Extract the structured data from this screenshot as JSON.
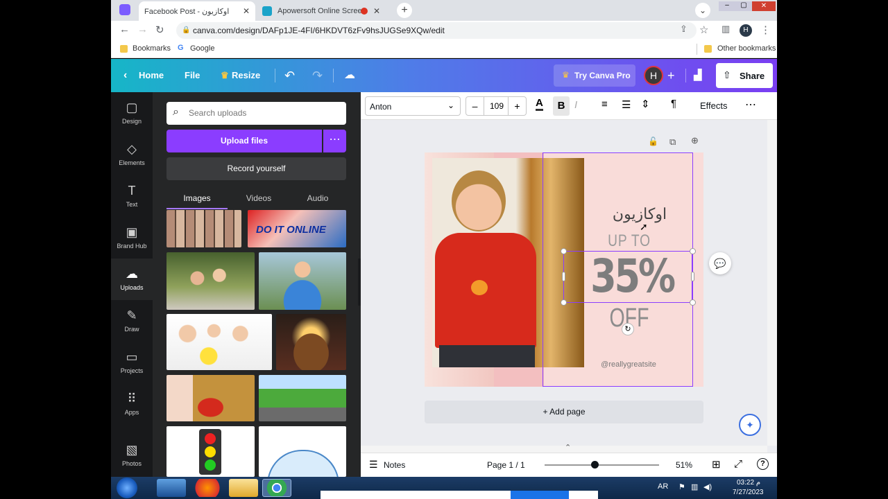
{
  "browser": {
    "tabs": [
      {
        "title": "Facebook Post - اوكازيون",
        "active": true
      },
      {
        "title": "Apowersoft Online Screen Re",
        "active": false
      }
    ],
    "url": "canva.com/design/DAFp1JE-4FI/6HKDVT6zFv9hsJUGSe9XQw/edit",
    "profile_initial": "H",
    "bookmarks": [
      "Bookmarks",
      "Google"
    ],
    "other_bookmarks": "Other bookmarks"
  },
  "canva_header": {
    "home": "Home",
    "file": "File",
    "resize": "Resize",
    "try_pro": "Try Canva Pro",
    "avatar_initial": "H",
    "share": "Share"
  },
  "rail": [
    {
      "label": "Design",
      "icon": "design-icon",
      "glyph": "▢"
    },
    {
      "label": "Elements",
      "icon": "elements-icon",
      "glyph": "◇"
    },
    {
      "label": "Text",
      "icon": "text-icon",
      "glyph": "T"
    },
    {
      "label": "Brand Hub",
      "icon": "brand-hub-icon",
      "glyph": "▣"
    },
    {
      "label": "Uploads",
      "icon": "cloud-upload-icon",
      "glyph": "☁"
    },
    {
      "label": "Draw",
      "icon": "draw-icon",
      "glyph": "✎"
    },
    {
      "label": "Projects",
      "icon": "folder-icon",
      "glyph": "▭"
    },
    {
      "label": "Apps",
      "icon": "apps-icon",
      "glyph": "⠿"
    },
    {
      "label": "Photos",
      "icon": "photos-icon",
      "glyph": "▧"
    }
  ],
  "uploads_panel": {
    "search_placeholder": "Search uploads",
    "upload_btn": "Upload files",
    "record_btn": "Record yourself",
    "tabs": [
      "Images",
      "Videos",
      "Audio"
    ],
    "thumb_text": "DO IT ONLINE"
  },
  "toolbar": {
    "font": "Anton",
    "font_size": "109",
    "effects": "Effects"
  },
  "canvas": {
    "arabic_title": "اوكازيون",
    "up_to": "UP TO",
    "percent": "35%",
    "off": "OFF",
    "handle": "@reallygreatsite",
    "add_page": "+ Add page"
  },
  "bottom": {
    "notes": "Notes",
    "page": "Page 1 / 1",
    "zoom": "51%",
    "zoom_fraction": 0.51
  },
  "taskbar": {
    "lang": "AR",
    "time": "03:22 م",
    "date": "7/27/2023"
  },
  "colors": {
    "canva_purple": "#8b3dff",
    "poster_pink": "#f9dcd9",
    "selection": "#8b3dff"
  }
}
